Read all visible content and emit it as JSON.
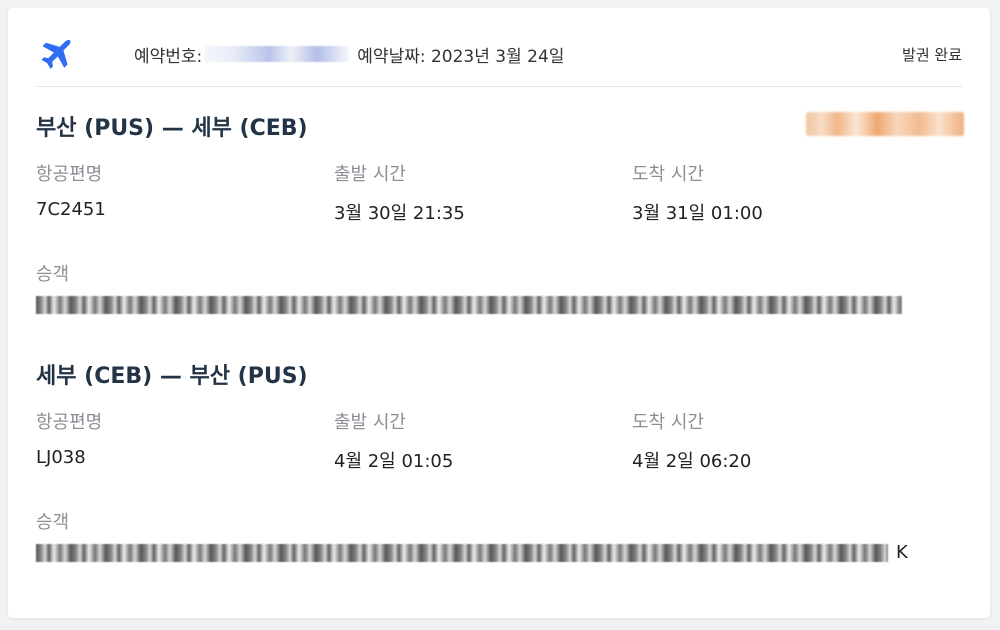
{
  "header": {
    "plane_icon_color": "#2f6df3",
    "booking_number_label": "예약번호:",
    "booking_date": "예약날짜: 2023년 3월 24일",
    "status": "발권 완료"
  },
  "flights": [
    {
      "route": "부산 (PUS) — 세부 (CEB)",
      "flight_label": "항공편명",
      "flight_number": "7C2451",
      "departure_label": "출발 시간",
      "departure_time": "3월 30일 21:35",
      "arrival_label": "도착 시간",
      "arrival_time": "3월 31일 01:00",
      "passenger_label": "승객"
    },
    {
      "route": "세부 (CEB) — 부산 (PUS)",
      "flight_label": "항공편명",
      "flight_number": "LJ038",
      "departure_label": "출발 시간",
      "departure_time": "4월 2일 01:05",
      "arrival_label": "도착 시간",
      "arrival_time": "4월 2일 06:20",
      "passenger_label": "승객",
      "passenger_tail": "K"
    }
  ]
}
